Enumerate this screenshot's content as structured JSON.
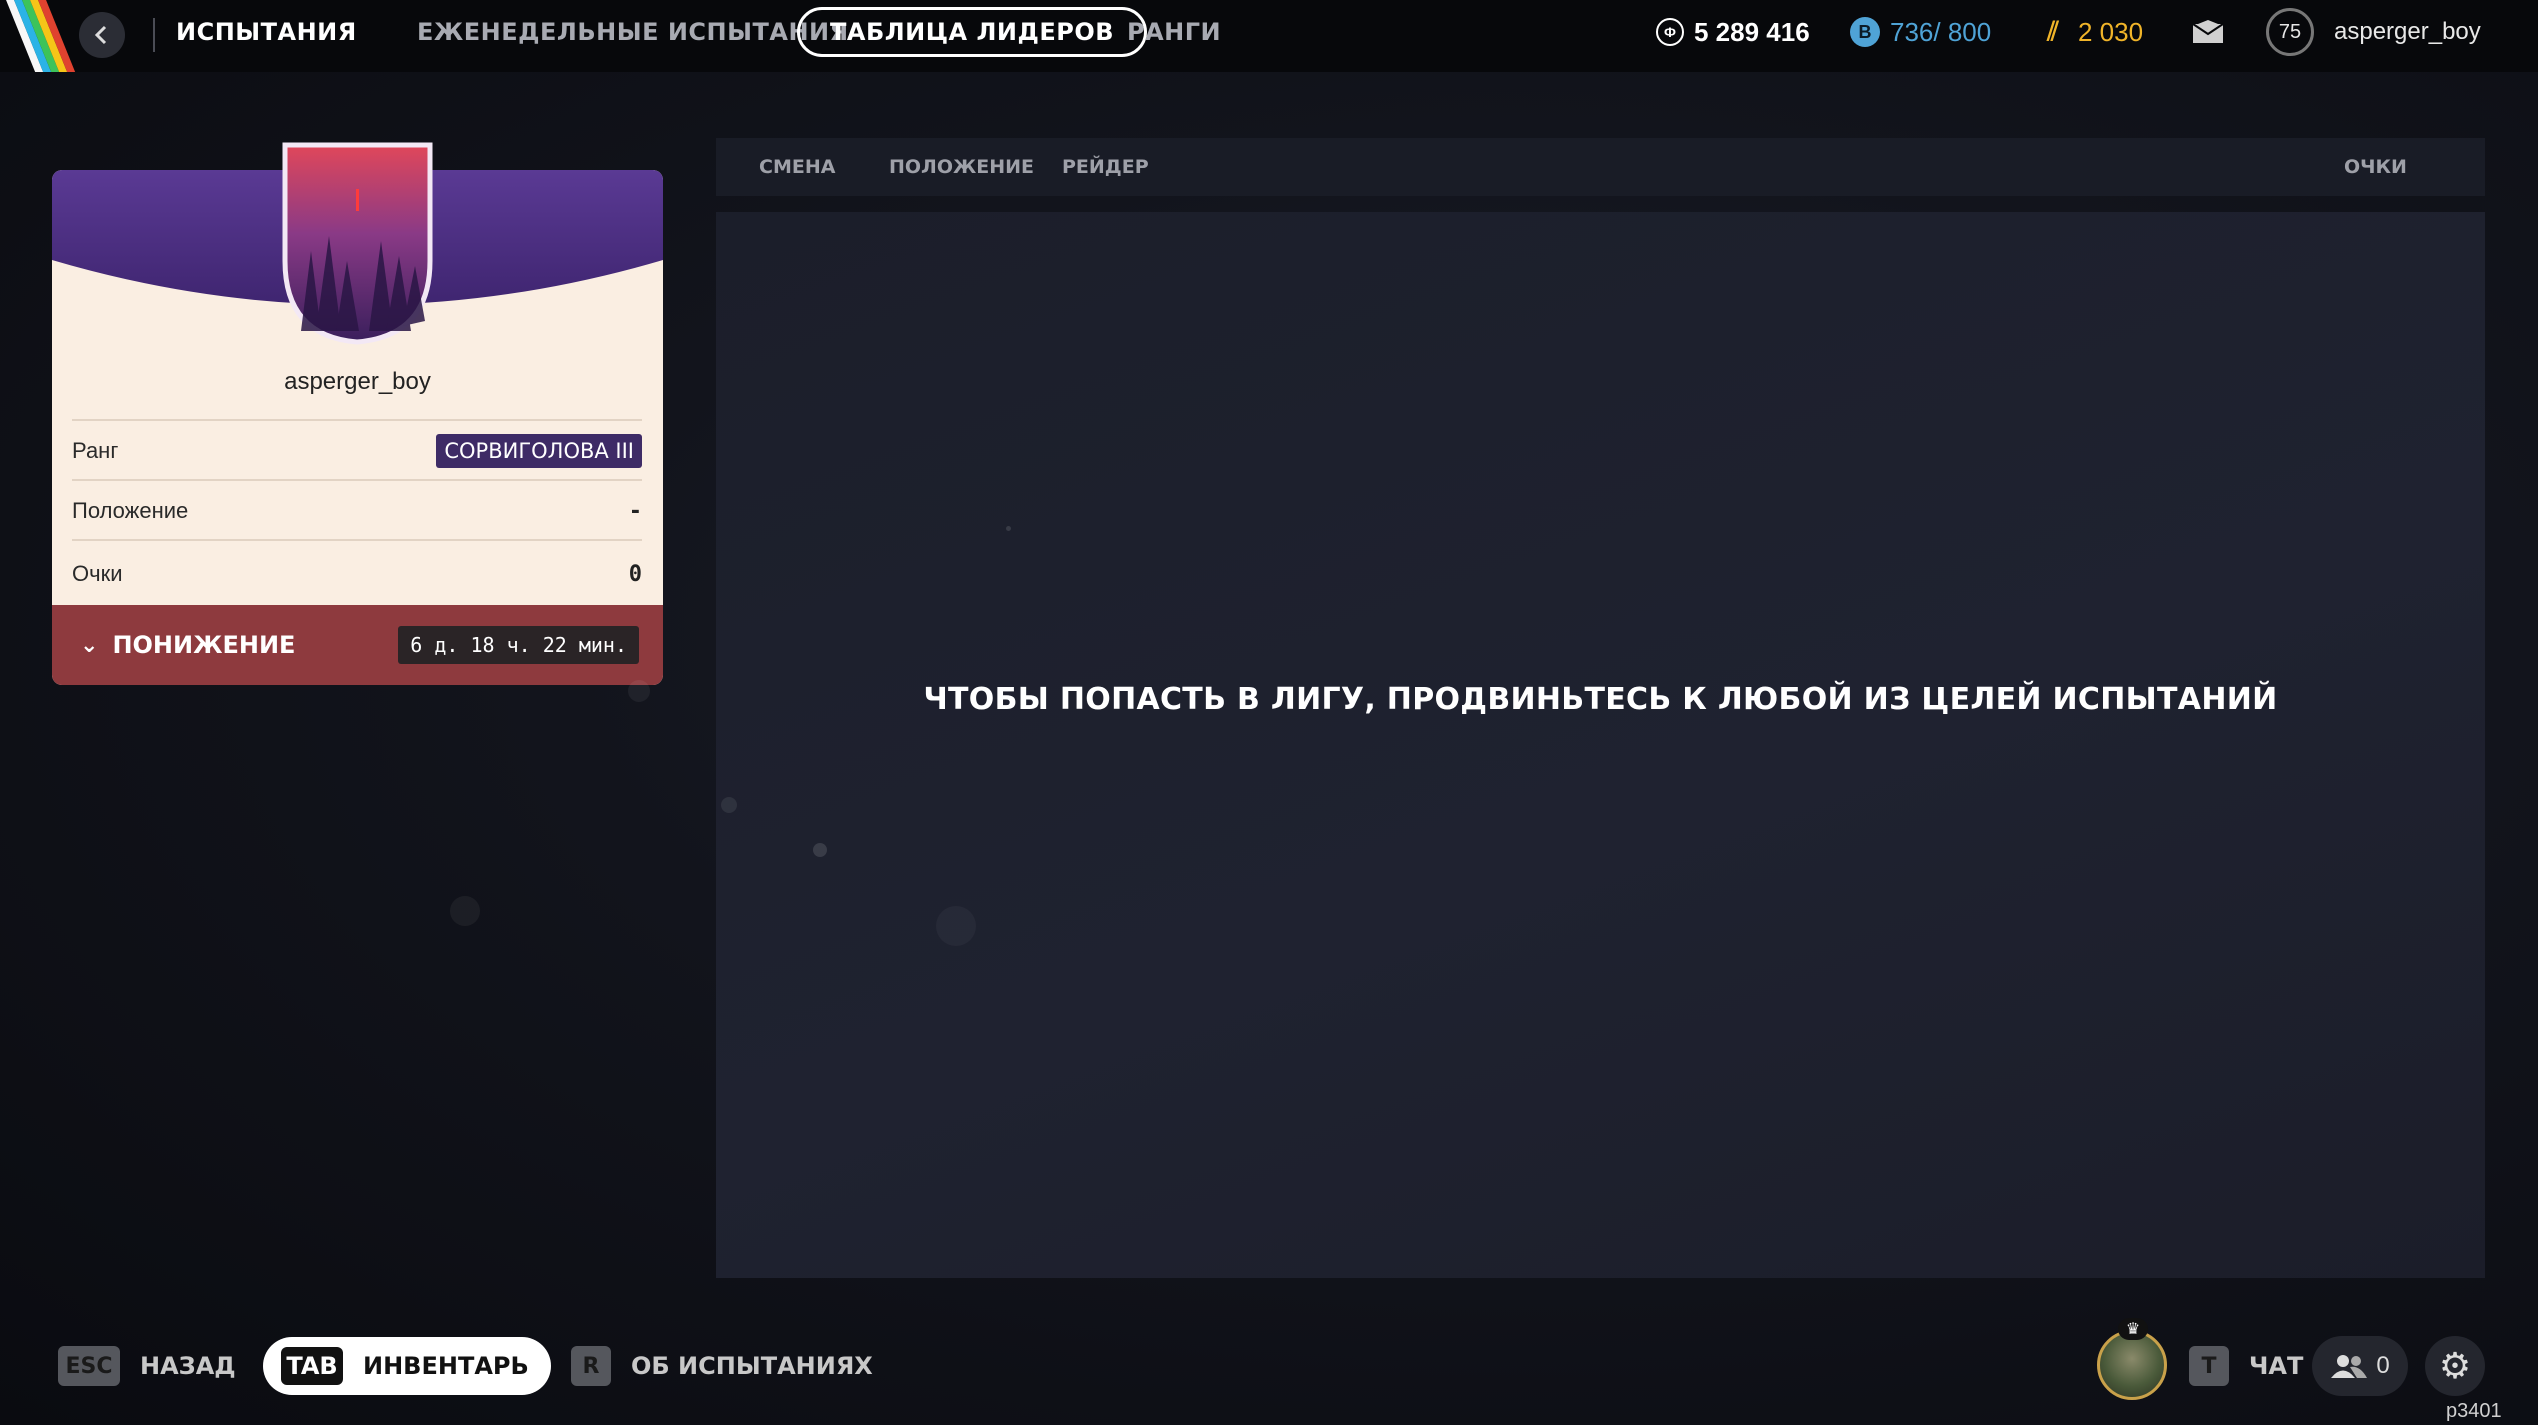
{
  "topbar": {
    "section_title": "ИСПЫТАНИЯ",
    "tabs": [
      {
        "label": "ЕЖЕНЕДЕЛЬНЫЕ ИСПЫТАНИЯ"
      },
      {
        "label": "ТАБЛИЦА ЛИДЕРОВ",
        "active": true
      },
      {
        "label": "РАНГИ"
      }
    ],
    "currencies": [
      {
        "icon": "credits-icon",
        "value": "5 289 416",
        "color": "#ffffff"
      },
      {
        "icon": "bonds-icon",
        "value": "736/ 800",
        "color": "#4fa3d6"
      },
      {
        "icon": "aurum-icon",
        "value": "2 030",
        "color": "#f0b429"
      }
    ],
    "level": "75",
    "username": "asperger_boy"
  },
  "profile": {
    "username": "asperger_boy",
    "rows": [
      {
        "label": "Ранг",
        "value": "СОРВИГОЛОВА III"
      },
      {
        "label": "Положение",
        "value": "-"
      },
      {
        "label": "Очки",
        "value": "0"
      }
    ],
    "demotion": {
      "label": "ПОНИЖЕНИЕ",
      "timer": "6 д. 18 ч. 22 мин."
    }
  },
  "leaderboard": {
    "columns": [
      "СМЕНА",
      "ПОЛОЖЕНИЕ",
      "РЕЙДЕР",
      "ОЧКИ"
    ],
    "empty_message": "ЧТОБЫ ПОПАСТЬ В ЛИГУ, ПРОДВИНЬТЕСЬ К ЛЮБОЙ ИЗ ЦЕЛЕЙ ИСПЫТАНИЙ"
  },
  "bottombar": {
    "back": {
      "key": "ESC",
      "label": "НАЗАД"
    },
    "inventory": {
      "key": "TAB",
      "label": "ИНВЕНТАРЬ"
    },
    "about": {
      "key": "R",
      "label": "ОБ ИСПЫТАНИЯХ"
    },
    "chat": {
      "key": "T",
      "label": "ЧАТ"
    },
    "party_count": "0",
    "version": "p3401"
  },
  "colors": {
    "accent_purple": "#3e2b66",
    "demotion_red": "#8e3a3e",
    "card_bg": "#faeee2"
  }
}
